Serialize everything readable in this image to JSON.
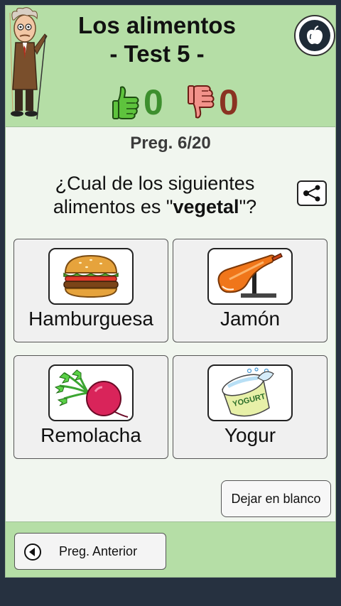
{
  "header": {
    "title_line1": "Los alimentos",
    "title_line2": "- Test 5 -",
    "correct_count": "0",
    "wrong_count": "0"
  },
  "question": {
    "counter": "Preg. 6/20",
    "text_before": "¿Cual de los siguientes alimentos es \"",
    "keyword": "vegetal",
    "text_after": "\"?"
  },
  "options": [
    {
      "label": "Hamburguesa",
      "icon": "hamburger-icon"
    },
    {
      "label": "Jamón",
      "icon": "ham-icon"
    },
    {
      "label": "Remolacha",
      "icon": "beet-icon"
    },
    {
      "label": "Yogur",
      "icon": "yogurt-icon"
    }
  ],
  "yogurt_can_text": "YOGURT",
  "blank_button": "Dejar en blanco",
  "prev_button": "Preg. Anterior",
  "colors": {
    "header_bg": "#b5dea6",
    "correct": "#3d8f2e",
    "wrong": "#8a3322",
    "background": "#f1f6ef"
  }
}
